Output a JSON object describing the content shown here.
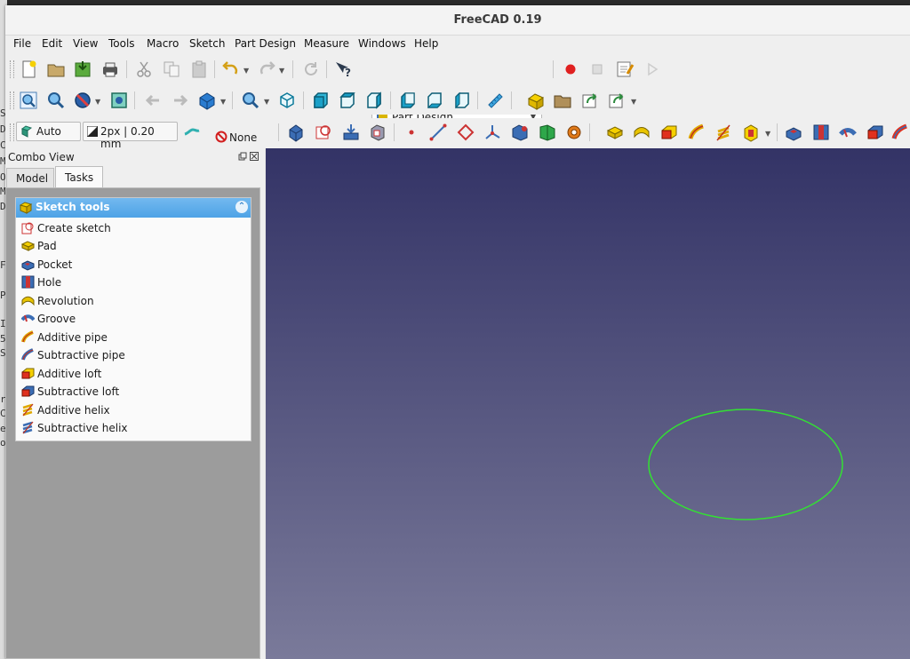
{
  "window": {
    "title": "FreeCAD 0.19"
  },
  "menu": [
    "File",
    "Edit",
    "View",
    "Tools",
    "Macro",
    "Sketch",
    "Part Design",
    "Measure",
    "Windows",
    "Help"
  ],
  "toolbar": {
    "workbench": "Part Design",
    "draw_style": "Auto",
    "line_width": "2px | 0.20 mm",
    "selection_filter": "None"
  },
  "combo": {
    "title": "Combo View",
    "tabs": [
      "Model",
      "Tasks"
    ],
    "active_tab": "Tasks",
    "panel_title": "Sketch tools",
    "items": [
      {
        "label": "Create sketch",
        "icon": "create-sketch-icon"
      },
      {
        "label": "Pad",
        "icon": "pad-icon"
      },
      {
        "label": "Pocket",
        "icon": "pocket-icon"
      },
      {
        "label": "Hole",
        "icon": "hole-icon"
      },
      {
        "label": "Revolution",
        "icon": "revolution-icon"
      },
      {
        "label": "Groove",
        "icon": "groove-icon"
      },
      {
        "label": "Additive pipe",
        "icon": "additive-pipe-icon"
      },
      {
        "label": "Subtractive pipe",
        "icon": "subtractive-pipe-icon"
      },
      {
        "label": "Additive loft",
        "icon": "additive-loft-icon"
      },
      {
        "label": "Subtractive loft",
        "icon": "subtractive-loft-icon"
      },
      {
        "label": "Additive helix",
        "icon": "additive-helix-icon"
      },
      {
        "label": "Subtractive helix",
        "icon": "subtractive-helix-icon"
      }
    ]
  },
  "background_terminal": [
    "S",
    "D",
    "C",
    "M",
    "O",
    "M",
    "D",
    "F",
    "P",
    "I",
    "5",
    "S",
    "r",
    "C",
    "e",
    "o"
  ],
  "colors": {
    "accent": "#4da3e6",
    "sketch_circle": "#33e033",
    "viewport_top": "#333366",
    "viewport_bottom": "#7a7a9a"
  }
}
